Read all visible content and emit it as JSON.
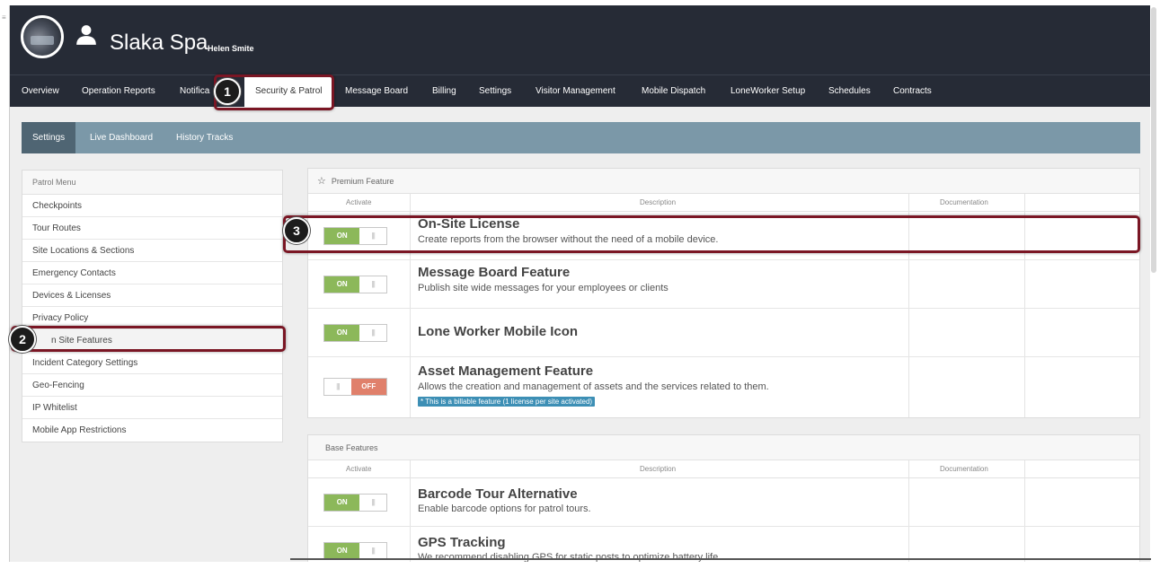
{
  "header": {
    "site_name": "Slaka Spa",
    "user_name": "Helen Smite"
  },
  "topnav": {
    "items": [
      "Overview",
      "Operation Reports",
      "Notifica",
      "Security & Patrol",
      "Message Board",
      "Billing",
      "Settings",
      "Visitor Management",
      "Mobile Dispatch",
      "LoneWorker Setup",
      "Schedules",
      "Contracts"
    ]
  },
  "subnav": {
    "tabs": [
      "Settings",
      "Live Dashboard",
      "History Tracks"
    ]
  },
  "patrol_menu": {
    "title": "Patrol Menu",
    "items": [
      "Checkpoints",
      "Tour Routes",
      "Site Locations & Sections",
      "Emergency Contacts",
      "Devices & Licenses",
      "Privacy Policy",
      "n Site Features",
      "Incident Category Settings",
      "Geo-Fencing",
      "IP Whitelist",
      "Mobile App Restrictions"
    ]
  },
  "columns": {
    "activate": "Activate",
    "description": "Description",
    "documentation": "Documentation"
  },
  "premium": {
    "title": "Premium Feature",
    "features": [
      {
        "title": "On-Site License",
        "desc": "Create reports from the browser without the need of a mobile device.",
        "state": "ON"
      },
      {
        "title": "Message Board Feature",
        "desc": "Publish site wide messages for your employees or clients",
        "state": "ON"
      },
      {
        "title": "Lone Worker Mobile Icon",
        "desc": "",
        "state": "ON"
      },
      {
        "title": "Asset Management Feature",
        "desc": "Allows the creation and management of assets and the services related to them.",
        "badge": "* This is a billable feature (1 license per site activated)",
        "state": "OFF"
      }
    ]
  },
  "base": {
    "title": "Base Features",
    "features": [
      {
        "title": "Barcode Tour Alternative",
        "desc": "Enable barcode options for patrol tours.",
        "state": "ON"
      },
      {
        "title": "GPS Tracking",
        "desc": "We recommend disabling GPS for static posts to optimize battery life.",
        "state": "ON"
      }
    ]
  },
  "toggle": {
    "grip": "|||"
  },
  "callouts": [
    "1",
    "2",
    "3"
  ],
  "colors": {
    "header_bg": "#262b36",
    "subnav_bg": "#7b98a8",
    "toggle_on": "#8cb85a",
    "toggle_off": "#e0806b",
    "highlight": "#7a1624"
  }
}
